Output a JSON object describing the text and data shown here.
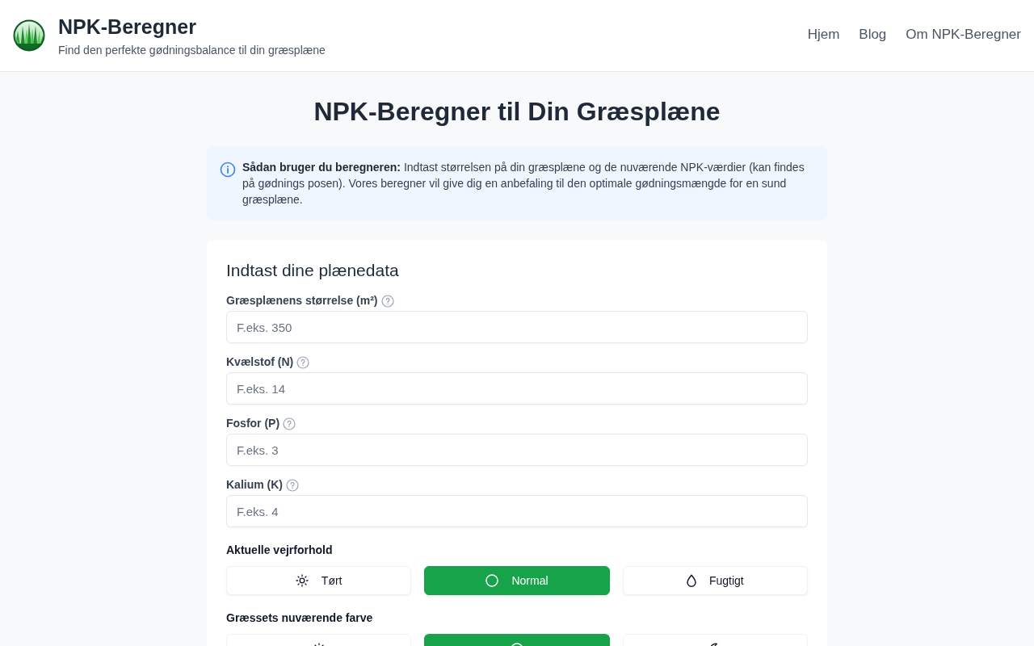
{
  "header": {
    "title": "NPK-Beregner",
    "subtitle": "Find den perfekte gødningsbalance til din græsplæne",
    "nav": [
      "Hjem",
      "Blog",
      "Om NPK-Beregner"
    ]
  },
  "page_title": "NPK-Beregner til Din Græsplæne",
  "info": {
    "text": "**Sådan bruger du beregneren:** Indtast størrelsen på din græsplæne og de nuværende NPK-værdier (kan findes på gødnings posen). Vores beregner vil give dig en anbefaling til den optimale gødningsmængde for en sund græsplæne."
  },
  "form": {
    "title": "Indtast dine plænedata",
    "fields": [
      {
        "label": "Græsplænens størrelse (m²)",
        "placeholder": "F.eks. 350"
      },
      {
        "label": "Kvælstof (N)",
        "placeholder": "F.eks. 14"
      },
      {
        "label": "Fosfor (P)",
        "placeholder": "F.eks. 3"
      },
      {
        "label": "Kalium (K)",
        "placeholder": "F.eks. 4"
      }
    ],
    "weather": {
      "label": "Aktuelle vejrforhold",
      "options": [
        {
          "kind": "dry",
          "label": "Tørt",
          "selected": false
        },
        {
          "kind": "normal",
          "label": "Normal",
          "selected": true
        },
        {
          "kind": "humid",
          "label": "Fugtigt",
          "selected": false
        }
      ]
    },
    "grass_color": {
      "label": "Græssets nuværende farve",
      "options": [
        {
          "kind": "light",
          "selected": false
        },
        {
          "kind": "normal",
          "selected": true
        },
        {
          "kind": "dark",
          "selected": false
        }
      ]
    }
  }
}
